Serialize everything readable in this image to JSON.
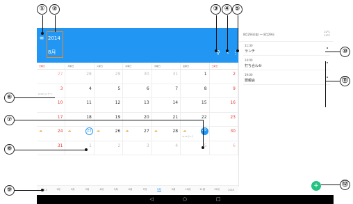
{
  "app": {
    "year": "2014",
    "month": "8月",
    "colors": {
      "primary": "#2196f3",
      "fab": "#26c281",
      "weekend": "#e53935",
      "callout": "#f08a24"
    }
  },
  "icons": {
    "menu": "menu-icon",
    "search": "search-icon",
    "back": "chevron-left-icon",
    "more": "more-vert-icon",
    "add": "add-icon"
  },
  "toolbar": {
    "menu_glyph": "≡",
    "search_glyph": "⚲",
    "back_glyph": "‹",
    "more_glyph": "⋮"
  },
  "calendar": {
    "weekdays": [
      "日曜日",
      "月曜日",
      "火曜日",
      "水曜日",
      "木曜日",
      "金曜日",
      "土曜日"
    ],
    "weeks": [
      [
        {
          "d": "27",
          "o": true
        },
        {
          "d": "28",
          "o": true
        },
        {
          "d": "29",
          "o": true
        },
        {
          "d": "30",
          "o": true
        },
        {
          "d": "31",
          "o": true
        },
        {
          "d": "1"
        },
        {
          "d": "2"
        }
      ],
      [
        {
          "d": "3",
          "ev": "10:00 コンサート"
        },
        {
          "d": "4"
        },
        {
          "d": "5"
        },
        {
          "d": "6"
        },
        {
          "d": "7"
        },
        {
          "d": "8"
        },
        {
          "d": "9"
        }
      ],
      [
        {
          "d": "10"
        },
        {
          "d": "11"
        },
        {
          "d": "12"
        },
        {
          "d": "13"
        },
        {
          "d": "14"
        },
        {
          "d": "15"
        },
        {
          "d": "16"
        }
      ],
      [
        {
          "d": "17"
        },
        {
          "d": "18"
        },
        {
          "d": "19"
        },
        {
          "d": "20"
        },
        {
          "d": "21"
        },
        {
          "d": "22"
        },
        {
          "d": "23"
        }
      ],
      [
        {
          "d": "24",
          "wx": true
        },
        {
          "d": "25",
          "sel": true,
          "wx": true
        },
        {
          "d": "26",
          "wx": true
        },
        {
          "d": "27",
          "wx": true
        },
        {
          "d": "28",
          "wx": true
        },
        {
          "d": "29",
          "today": true,
          "wx": true,
          "ev": "11:30 ランチ"
        },
        {
          "d": "30"
        }
      ],
      [
        {
          "d": "31"
        },
        {
          "d": "1",
          "o": true
        },
        {
          "d": "2",
          "o": true
        },
        {
          "d": "3",
          "o": true
        },
        {
          "d": "4",
          "o": true
        },
        {
          "d": "5",
          "o": true
        },
        {
          "d": "6",
          "o": true
        }
      ]
    ]
  },
  "yearbar": [
    "2013",
    "1月",
    "2月",
    "3月",
    "4月",
    "5月",
    "6月",
    "7月",
    "8月",
    "9月",
    "10月",
    "11月",
    "12月",
    "2015"
  ],
  "yearbar_selected": "8月",
  "side": {
    "range": "8月29日(金) ～ 8月29日",
    "temp_high": "22°C",
    "temp_low": "14°C",
    "events": [
      {
        "time": "11:30",
        "name": "ランチ"
      },
      {
        "time": "14:00",
        "name": "打ち合わせ"
      },
      {
        "time": "19:00",
        "name": "懇親会"
      }
    ]
  },
  "fab_label": "+",
  "nav": {
    "back": "◁",
    "home": "○",
    "recents": "□"
  },
  "callouts": [
    "①",
    "②",
    "③",
    "④",
    "⑤",
    "⑥",
    "⑦",
    "⑧",
    "⑨",
    "⑩",
    "⑪",
    "⑫"
  ]
}
